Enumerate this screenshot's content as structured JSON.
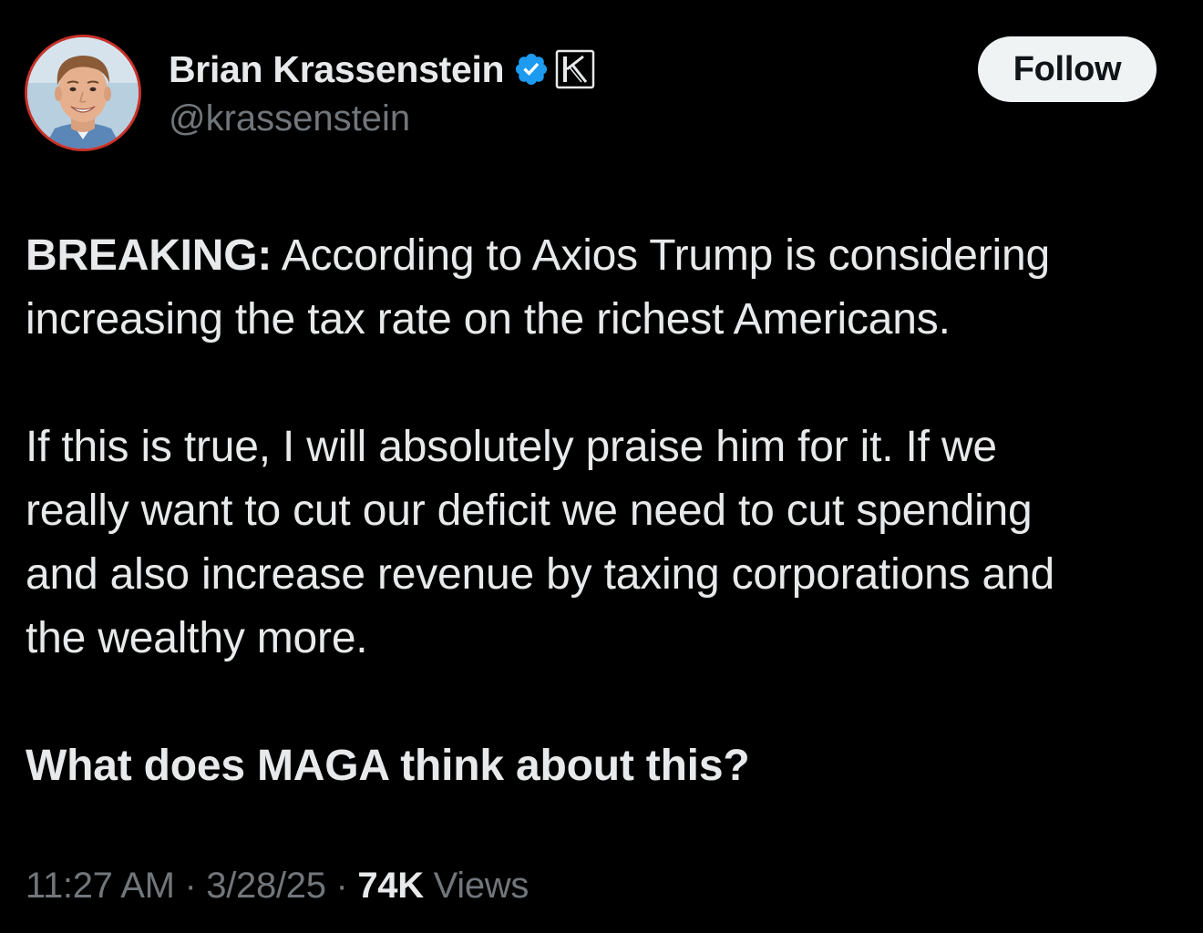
{
  "author": {
    "display_name": "Brian Krassenstein",
    "handle": "@krassenstein",
    "verified_icon": "verified-badge-icon",
    "affiliate_icon": "affiliate-k-badge-icon",
    "avatar_border_color": "#c8322a",
    "verified_color": "#1d9bf0"
  },
  "follow_button": {
    "label": "Follow"
  },
  "tweet": {
    "breaking_label": "BREAKING:",
    "paragraph1_rest_line1": " According to Axios Trump is considering",
    "paragraph1_line2": "increasing the tax rate on the richest Americans.",
    "paragraph2_line1": "If this is true, I will absolutely praise him for it.  If we",
    "paragraph2_line2": "really want to cut our deficit we need to cut spending",
    "paragraph2_line3": "and also increase revenue by taxing corporations and",
    "paragraph2_line4": "the wealthy more.",
    "paragraph3": "What does MAGA think about this?"
  },
  "meta": {
    "time": "11:27 AM",
    "separator1": " · ",
    "date": "3/28/25",
    "separator2": " · ",
    "views_count": "74K",
    "views_label": " Views"
  }
}
